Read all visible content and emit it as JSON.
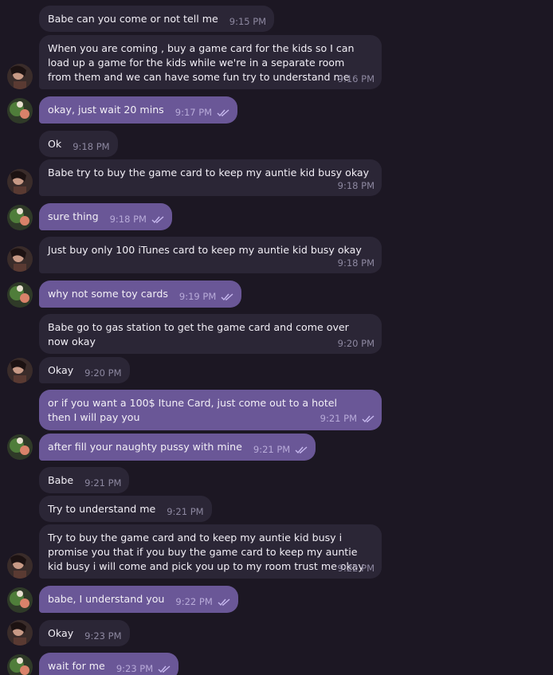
{
  "messages": [
    {
      "text": "Babe can you come or not tell me",
      "time": "9:15 PM"
    },
    {
      "text": "When you are coming , buy  a   game card for the kids so I can load up a game for the kids while we're in a separate room from them and we can have some fun try to understand me",
      "time": "9:16 PM"
    },
    {
      "text": "okay, just wait 20 mins",
      "time": "9:17 PM"
    },
    {
      "text": "Ok",
      "time": "9:18 PM"
    },
    {
      "text": "Babe try to buy the game card to keep my auntie kid busy okay",
      "time": "9:18 PM"
    },
    {
      "text": "sure thing",
      "time": "9:18 PM"
    },
    {
      "text": "Just buy only 100 iTunes card to keep my auntie kid busy okay",
      "time": "9:18 PM"
    },
    {
      "text": "why not some toy cards",
      "time": "9:19 PM"
    },
    {
      "text": "Babe go to gas station to get the game card and come over now okay",
      "time": "9:20 PM"
    },
    {
      "text": "Okay",
      "time": "9:20 PM"
    },
    {
      "text": "or if you want a 100$ Itune Card, just come out to a hotel then I will pay you",
      "time": "9:21 PM"
    },
    {
      "text": "after fill your naughty pussy with mine",
      "time": "9:21 PM"
    },
    {
      "text": "Babe",
      "time": "9:21 PM"
    },
    {
      "text": "Try to understand me",
      "time": "9:21 PM"
    },
    {
      "text": "Try to buy the game card and to keep my auntie kid busy i promise you that if you buy the game card to keep my auntie kid busy i will come and pick you up to my room trust me okay",
      "time": "9:22 PM"
    },
    {
      "text": "babe, I understand you",
      "time": "9:22 PM"
    },
    {
      "text": "Okay",
      "time": "9:23 PM"
    },
    {
      "text": "wait for me",
      "time": "9:23 PM"
    }
  ],
  "colors": {
    "background": "#1c1723",
    "incoming_bubble": "#2b2636",
    "outgoing_bubble": "#6a5797",
    "read_ticks": "#c7b9ef"
  }
}
